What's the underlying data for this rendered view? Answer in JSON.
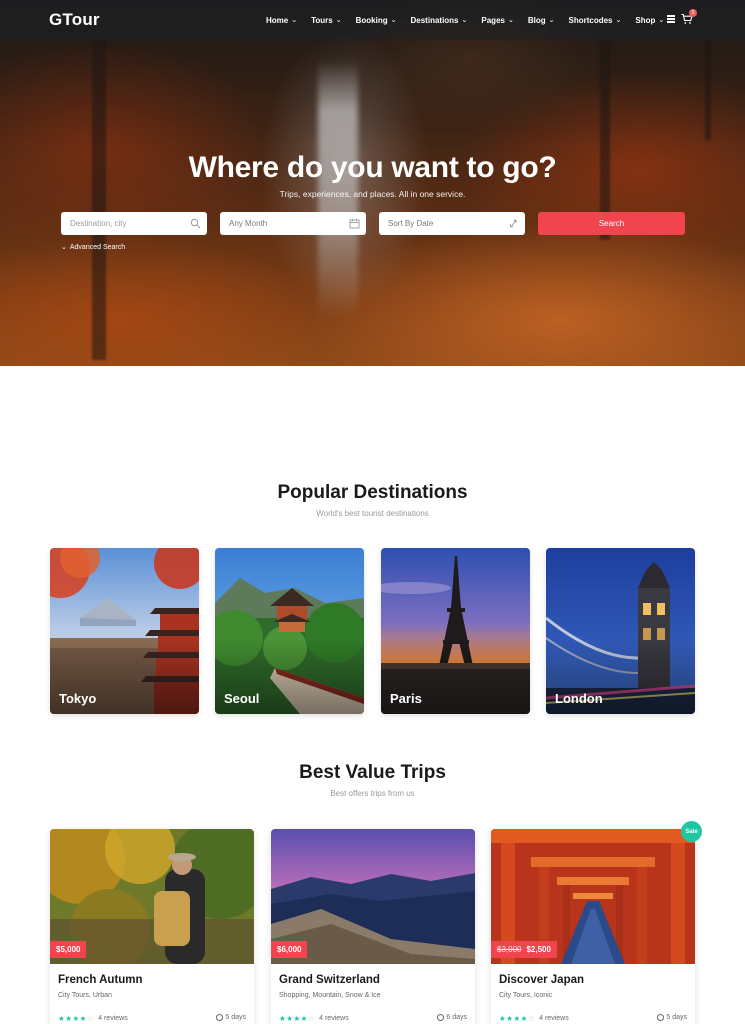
{
  "brand": {
    "logo": "GTour",
    "accent": "#f0454f",
    "teal": "#1ec6a4"
  },
  "nav": {
    "items": [
      {
        "label": "Home"
      },
      {
        "label": "Tours"
      },
      {
        "label": "Booking"
      },
      {
        "label": "Destinations"
      },
      {
        "label": "Pages"
      },
      {
        "label": "Blog"
      },
      {
        "label": "Shortcodes"
      },
      {
        "label": "Shop"
      }
    ],
    "menu_icon": "hamburger-icon",
    "cart_icon": "cart-icon",
    "cart_count": "0"
  },
  "hero": {
    "title": "Where do you want to go?",
    "subtitle": "Trips, experiences, and places. All in one service.",
    "destination_placeholder": "Destination, city",
    "month_value": "Any Month",
    "sort_value": "Sort By Date",
    "search_label": "Search",
    "advanced_label": "Advanced Search"
  },
  "popular": {
    "title": "Popular Destinations",
    "subtitle": "World's best tourist destinations",
    "destinations": [
      {
        "name": "Tokyo"
      },
      {
        "name": "Seoul"
      },
      {
        "name": "Paris"
      },
      {
        "name": "London"
      }
    ]
  },
  "trips": {
    "title": "Best Value Trips",
    "subtitle": "Best offers trips from us",
    "sale_label": "Sale",
    "items": [
      {
        "title": "French Autumn",
        "tags": "City Tours, Urban",
        "price": "$5,000",
        "old_price": "",
        "reviews": "4 reviews",
        "days": "5 days",
        "rating": 4
      },
      {
        "title": "Grand Switzerland",
        "tags": "Shopping, Mountain, Snow & Ice",
        "price": "$6,000",
        "old_price": "",
        "reviews": "4 reviews",
        "days": "6 days",
        "rating": 4
      },
      {
        "title": "Discover Japan",
        "tags": "City Tours, Iconic",
        "price": "$2,500",
        "old_price": "$3,000",
        "reviews": "4 reviews",
        "days": "5 days",
        "rating": 4
      }
    ]
  }
}
